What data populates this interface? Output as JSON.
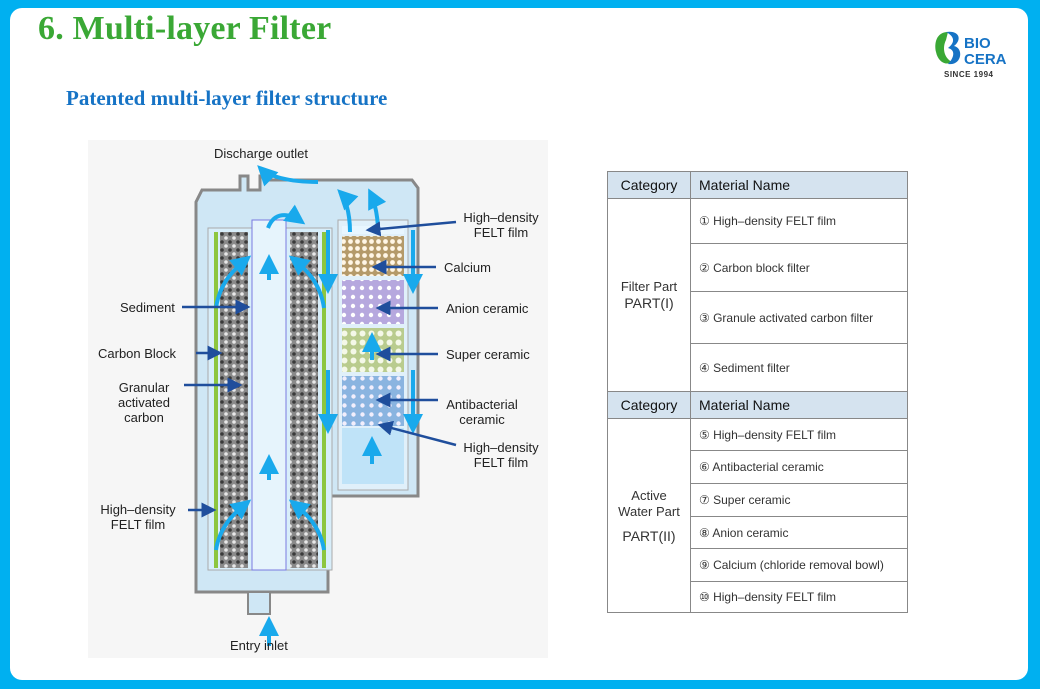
{
  "title": "6. Multi-layer Filter",
  "subtitle": "Patented multi-layer filter structure",
  "logo": {
    "line1": "BIO",
    "line2": "CERA",
    "since": "SINCE 1994",
    "colors": {
      "green": "#3aa835",
      "blue": "#1673c5"
    }
  },
  "colors": {
    "frame": "#00b0f0",
    "title": "#3aa835",
    "subtitle": "#1673c5",
    "table_header": "#d5e3ef",
    "flow_arrow": "#19a9ec",
    "label_arrow": "#1f4e9c"
  },
  "diagram": {
    "labels": {
      "discharge_outlet": "Discharge outlet",
      "entry_inlet": "Entry inlet",
      "sediment": "Sediment",
      "carbon_block": "Carbon Block",
      "granular": "Granular activated carbon",
      "felt_left": "High–density FELT film",
      "felt_top": "High–density FELT film",
      "calcium": "Calcium",
      "anion": "Anion ceramic",
      "super": "Super ceramic",
      "antibacterial": "Antibacterial ceramic",
      "felt_bottom": "High–density FELT film"
    }
  },
  "table": {
    "header": {
      "category": "Category",
      "material": "Material Name"
    },
    "sections": [
      {
        "category_line1": "Filter Part",
        "category_line2": "PART(I)",
        "items": [
          "① High–density FELT film",
          "② Carbon block filter",
          "③ Granule activated carbon filter",
          "④ Sediment filter"
        ]
      },
      {
        "category_line1": "Active Water Part",
        "category_line2": "PART(II)",
        "items": [
          "⑤ High–density FELT film",
          "⑥ Antibacterial ceramic",
          "⑦ Super ceramic",
          "⑧ Anion ceramic",
          "⑨ Calcium (chloride removal bowl)",
          "⑩ High–density FELT film"
        ]
      }
    ]
  }
}
